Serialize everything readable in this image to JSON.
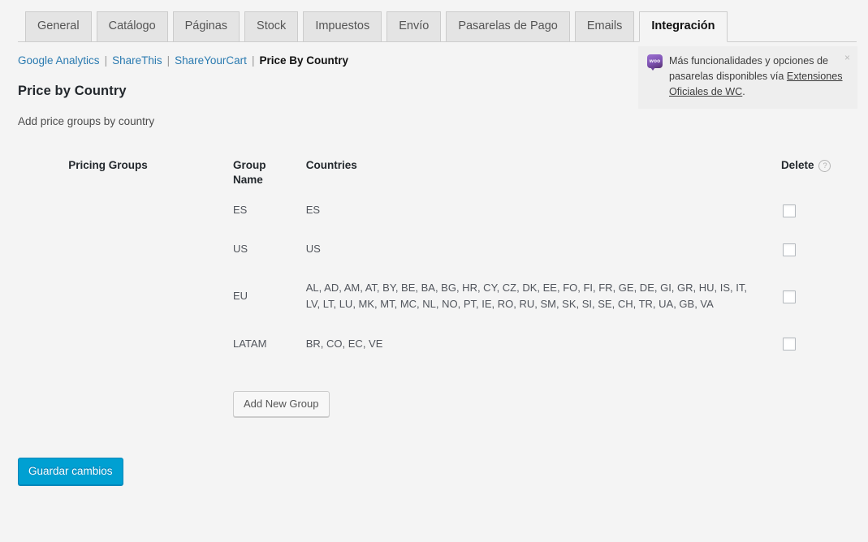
{
  "tabs": [
    {
      "label": "General",
      "active": false
    },
    {
      "label": "Catálogo",
      "active": false
    },
    {
      "label": "Páginas",
      "active": false
    },
    {
      "label": "Stock",
      "active": false
    },
    {
      "label": "Impuestos",
      "active": false
    },
    {
      "label": "Envío",
      "active": false
    },
    {
      "label": "Pasarelas de Pago",
      "active": false
    },
    {
      "label": "Emails",
      "active": false
    },
    {
      "label": "Integración",
      "active": true
    }
  ],
  "subnav": {
    "items": [
      {
        "label": "Google Analytics",
        "current": false
      },
      {
        "label": "ShareThis",
        "current": false
      },
      {
        "label": "ShareYourCart",
        "current": false
      },
      {
        "label": "Price By Country",
        "current": true
      }
    ],
    "separator": "|"
  },
  "notice": {
    "icon": "woocommerce-logo-icon",
    "icon_text": "woo",
    "text_before": "Más funcionalidades y opciones de pasarelas disponibles vía ",
    "link_label": "Extensiones Oficiales de WC",
    "text_after": ".",
    "dismiss_label": "×"
  },
  "page": {
    "title": "Price by Country",
    "subtitle": "Add price groups by country"
  },
  "section": {
    "label": "Pricing Groups"
  },
  "table": {
    "headers": {
      "group_name": "Group Name",
      "countries": "Countries",
      "delete": "Delete",
      "delete_help": "?"
    },
    "rows": [
      {
        "group_name": "ES",
        "countries": "ES",
        "delete_checked": false
      },
      {
        "group_name": "US",
        "countries": "US",
        "delete_checked": false
      },
      {
        "group_name": "EU",
        "countries": "AL, AD, AM, AT, BY, BE, BA, BG, HR, CY, CZ, DK, EE, FO, FI, FR, GE, DE, GI, GR, HU, IS, IT, LV, LT, LU, MK, MT, MC, NL, NO, PT, IE, RO, RU, SM, SK, SI, SE, CH, TR, UA, GB, VA",
        "delete_checked": false
      },
      {
        "group_name": "LATAM",
        "countries": "BR, CO, EC, VE",
        "delete_checked": false
      }
    ],
    "add_button": "Add New Group"
  },
  "submit": {
    "label": "Guardar cambios"
  },
  "colors": {
    "page_background": "#f4f4f4",
    "primary_button": "#00a0d2",
    "link": "#2a7ab0",
    "woo_purple": "#7f54b3",
    "notice_background": "#eeeeee"
  }
}
